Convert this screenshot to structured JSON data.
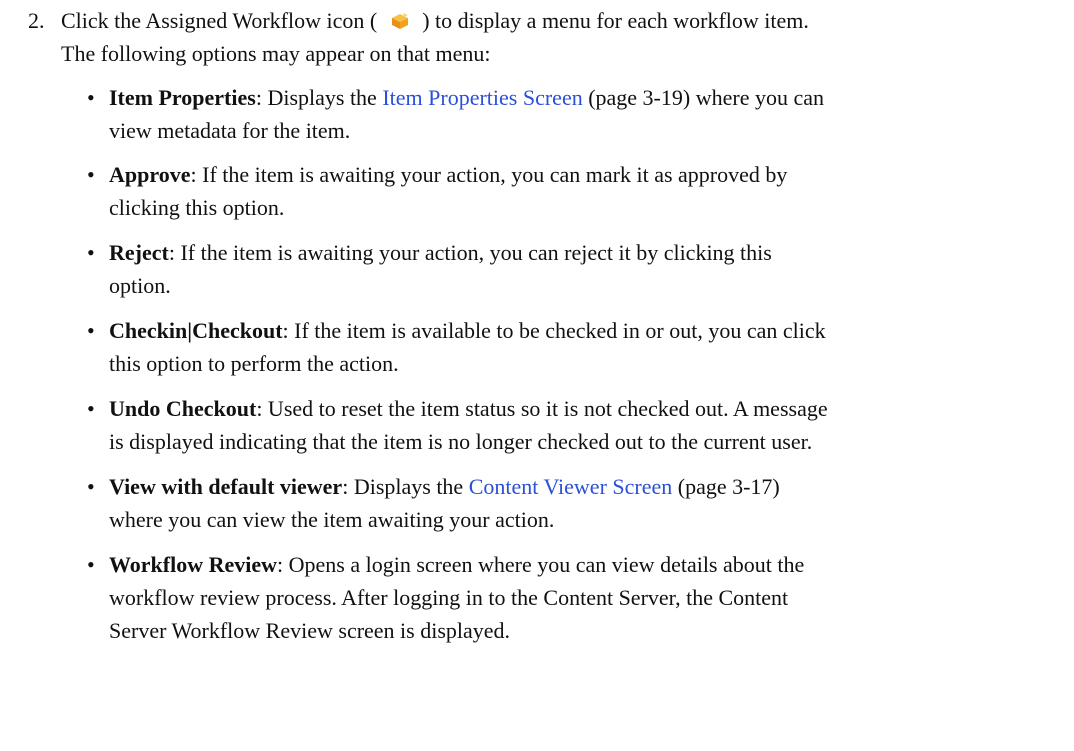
{
  "step": {
    "number": "2.",
    "text_before_icon": "Click the Assigned Workflow icon (",
    "icon": "assigned-workflow-icon",
    "text_after_icon": ") to display a menu for each workflow item.",
    "line2": "The following options may appear on that menu:"
  },
  "bullets": [
    {
      "term": "Item Properties",
      "before_link": ": Displays the ",
      "link": "Item Properties Screen",
      "after_link": " (page 3-19) where you can",
      "line2": "view metadata for the item."
    },
    {
      "term": "Approve",
      "text": ": If the item is awaiting your action, you can mark it as approved by",
      "line2": "clicking this option."
    },
    {
      "term": "Reject",
      "text": ": If the item is awaiting your action, you can reject it by clicking this",
      "line2": "option."
    },
    {
      "term": "Checkin|Checkout",
      "text": ": If the item is available to be checked in or out, you can click",
      "line2": "this option to perform the action."
    },
    {
      "term": "Undo Checkout",
      "text": ": Used to reset the item status so it is not checked out. A message",
      "line2": "is displayed indicating that the item is no longer checked out to the current user."
    },
    {
      "term": "View with default viewer",
      "before_link": ": Displays the ",
      "link": "Content Viewer Screen",
      "after_link": " (page 3-17)",
      "line2": "where you can view the item awaiting your action."
    },
    {
      "term": "Workflow Review",
      "text": ": Opens a login screen where you can view details about the",
      "line2": "workflow review process. After logging in to the Content Server, the Content",
      "line3": "Server Workflow Review screen is displayed."
    }
  ],
  "bullet_char": "•",
  "colors": {
    "text": "#111111",
    "link": "#2b4fd6",
    "icon_orange": "#f0a21c"
  }
}
